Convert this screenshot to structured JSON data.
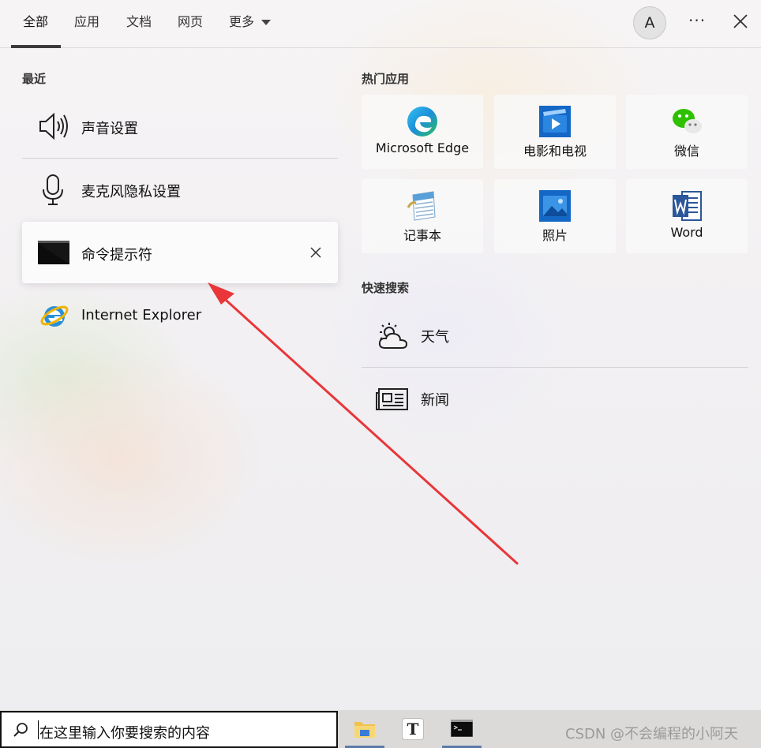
{
  "tabs": [
    {
      "label": "全部"
    },
    {
      "label": "应用"
    },
    {
      "label": "文档"
    },
    {
      "label": "网页"
    },
    {
      "label": "更多"
    }
  ],
  "account": {
    "initial": "A"
  },
  "more_glyph": "···",
  "recent": {
    "title": "最近",
    "items": [
      {
        "label": "声音设置",
        "icon": "speaker-icon"
      },
      {
        "label": "麦克风隐私设置",
        "icon": "microphone-icon"
      },
      {
        "label": "命令提示符",
        "icon": "cmd-icon"
      },
      {
        "label": "Internet Explorer",
        "icon": "ie-icon"
      }
    ]
  },
  "top_apps": {
    "title": "热门应用",
    "items": [
      {
        "label": "Microsoft Edge",
        "icon": "edge-icon"
      },
      {
        "label": "电影和电视",
        "icon": "movies-tv-icon"
      },
      {
        "label": "微信",
        "icon": "wechat-icon"
      },
      {
        "label": "记事本",
        "icon": "notepad-icon"
      },
      {
        "label": "照片",
        "icon": "photos-icon"
      },
      {
        "label": "Word",
        "icon": "word-icon"
      }
    ]
  },
  "quick_search": {
    "title": "快速搜索",
    "items": [
      {
        "label": "天气",
        "icon": "weather-icon"
      },
      {
        "label": "新闻",
        "icon": "news-icon"
      }
    ]
  },
  "search": {
    "placeholder": "在这里输入你要搜索的内容"
  },
  "taskbar": {
    "items": [
      {
        "icon": "file-explorer-icon"
      },
      {
        "icon": "typora-icon",
        "glyph": "T"
      },
      {
        "icon": "cmd-taskbar-icon"
      }
    ]
  },
  "watermark": "CSDN @不会编程的小阿天",
  "colors": {
    "annotation_arrow": "#e8363a",
    "accent": "#0078d4"
  }
}
